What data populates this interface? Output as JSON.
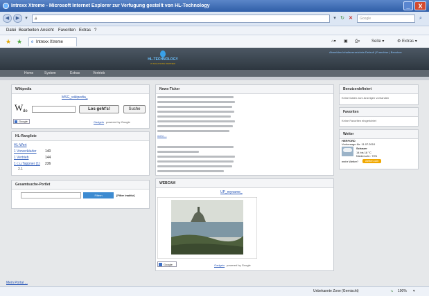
{
  "window": {
    "title": "Intrexx Xtreme - Microsoft Internet Explorer  zur Verfugung gestellt von HL-Technology",
    "minimize_glyph": "_",
    "close_glyph": "X"
  },
  "address": {
    "url": "#",
    "search_placeholder": "Google"
  },
  "menu": [
    "Datei",
    "Bearbeiten",
    "Ansicht",
    "Favoriten",
    "Extras",
    "?"
  ],
  "favorites_bar": {
    "tab_label": "Intrexx Xtreme",
    "page_label": "Seite",
    "tools_label": "Extras"
  },
  "site": {
    "logo_name": "HL-TECHNOLOGY",
    "logo_claim": "IT-SOLUTIONS PARTNER",
    "top_links": "Abmelden  Inhaltsverzeichnis  Default  |  Franchise  |  Benutzer"
  },
  "nav": [
    "Home",
    "System",
    "Extras",
    "Vertrieb"
  ],
  "wikipedia": {
    "title": "Wikipedia",
    "link": "MSG_wikipedia_",
    "w_letter": "W",
    "de": "de",
    "go_button": "Los geht's!",
    "search_button": "Suche",
    "google_badge": "Google",
    "gadgets": "Gadgets",
    "powered": "powered by Google"
  },
  "hl_rangliste": {
    "title": "HL-Rangliste",
    "rows": [
      {
        "name": "HL-Wert",
        "value": ""
      },
      {
        "name": "1 Vorverkäufer",
        "value": "140"
      },
      {
        "name": "1 Vertrieb",
        "value": "144"
      },
      {
        "name": "1 c.u.Tappner (1)",
        "value": "236"
      }
    ],
    "extra": "2.1"
  },
  "gesamtsuche": {
    "title": "Gesamtsuche-Portlet",
    "button": "Filtern",
    "filter_label": "[Filter inaktiv]"
  },
  "news": {
    "title": "News-Ticker",
    "more": "mehr ..."
  },
  "webcam": {
    "title": "WEBCAM",
    "link": "UP_myname_",
    "google_badge": "Google",
    "gadgets": "Gadgets",
    "powered": "powered by Google"
  },
  "benutzer": {
    "title": "Benutzerdefiniert",
    "text": "Keine Daten zum Anzeigen vorhanden"
  },
  "favoriten": {
    "title": "Favoriten",
    "text": "Keine Favoriten eingerichtet"
  },
  "wetter": {
    "title": "Wetter",
    "city": "HERFORD",
    "date": "Vorhersage für: 11.07.2010",
    "condition": "Schauer",
    "temp": "14 bis 18 °C",
    "rain": "Niederschl.: 70%",
    "more": "mehr Wetter?",
    "badge": "wetter.com"
  },
  "footer": {
    "portal_link": "Mein Portal ..."
  },
  "status": {
    "zone": "Unbekannte Zone (Gemischt)",
    "zoom": "100%"
  }
}
